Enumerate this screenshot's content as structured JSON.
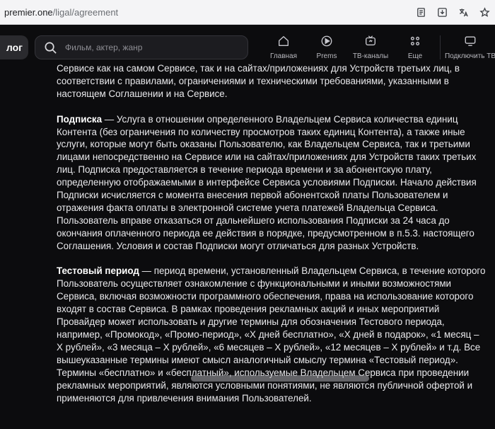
{
  "browser": {
    "url_host": "premier.one",
    "url_path": "/ligal/agreement"
  },
  "header": {
    "catalog_label": "лог",
    "search_placeholder": "Фильм, актер, жанр",
    "nav": [
      {
        "label": "Главная",
        "icon": "home-icon"
      },
      {
        "label": "Prems",
        "icon": "play-circle-icon"
      },
      {
        "label": "ТВ-каналы",
        "icon": "tv-icon"
      },
      {
        "label": "Еще",
        "icon": "more-grid-icon"
      },
      {
        "label": "Подключить ТВ",
        "icon": "monitor-icon"
      }
    ]
  },
  "document": {
    "intro": "Сервисе как на самом Сервисе, так и на сайтах/приложениях для Устройств третьих лиц, в соответствии с правилами, ограничениями и техническими требованиями, указанными в настоящем Соглашении и на Сервисе.",
    "sections": [
      {
        "term": "Подписка",
        "text": " — Услуга в отношении определенного Владельцем Сервиса количества единиц Контента (без ограничения по количеству просмотров таких единиц Контента), а также иные услуги, которые могут быть оказаны Пользователю, как Владельцем Сервиса, так и третьими лицами непосредственно на Сервисе или на сайтах/приложениях для Устройств таких третьих лиц. Подписка предоставляется в течение периода времени и за абонентскую плату, определенную отображаемыми в интерфейсе Сервиса условиями Подписки. Начало действия Подписки исчисляется с момента внесения первой абонентской платы Пользователем и отражения факта оплаты в электронной системе учета платежей Владельца Сервиса. Пользователь вправе отказаться от дальнейшего использования Подписки за 24 часа до окончания оплаченного периода ее действия в порядке, предусмотренном в п.5.3. настоящего Соглашения. Условия и состав Подписки могут отличаться для разных Устройств."
      },
      {
        "term": "Тестовый период",
        "text": " — период времени, установленный Владельцем Сервиса, в течение которого Пользователь осуществляет ознакомление с функциональными и иными возможностями Сервиса, включая возможности программного обеспечения, права на использование которого входят в состав Сервиса. В рамках проведения рекламных акций и иных мероприятий Провайдер может использовать и другие термины для обозначения Тестового периода, например, «Промокод», «Промо-период», «Х дней бесплатно», «Х дней в подарок», «1 месяц – Х рублей», «3 месяца – Х рублей», «6 месяцев – Х рублей», «12 месяцев – Х рублей» и т.д. Все вышеуказанные термины имеют смысл аналогичный смыслу термина «Тестовый период». Термины «бесплатно» и «бесплатный», используемые Владельцем Сервиса при проведении рекламных мероприятий, являются условными понятиями, не являются публичной офертой и применяются для привлечения внимания Пользователей."
      }
    ]
  },
  "colors": {
    "page_bg": "#0c0c0e",
    "text": "#e9e9ec",
    "browser_bar": "#f4f4f6"
  }
}
